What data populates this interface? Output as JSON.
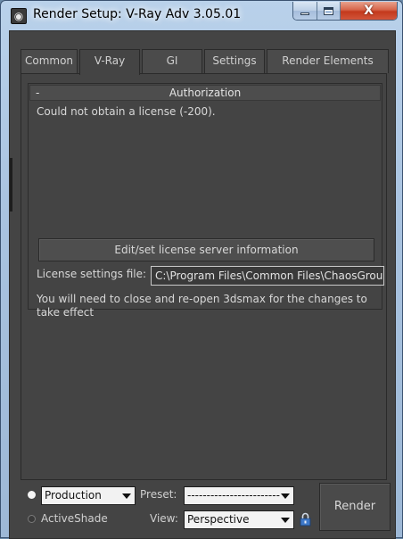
{
  "window": {
    "title": "Render Setup: V-Ray Adv 3.05.01",
    "app_icon": "3ds-max-icon",
    "caption_buttons": [
      "minimize-icon",
      "maximize-icon",
      "close-icon"
    ],
    "close_glyph": "X"
  },
  "tabs": [
    {
      "label": "Common",
      "active": false
    },
    {
      "label": "V-Ray",
      "active": true
    },
    {
      "label": "GI",
      "active": false
    },
    {
      "label": "Settings",
      "active": false
    },
    {
      "label": "Render Elements",
      "active": false
    }
  ],
  "authorization": {
    "toggle": "-",
    "title": "Authorization",
    "error_text": "Could not obtain a license (-200).",
    "edit_button_label": "Edit/set license server information",
    "license_file_label": "License settings file:",
    "license_file_value": "C:\\Program Files\\Common Files\\ChaosGrou",
    "restart_note": "You will need to close and re-open 3dsmax for the changes to take effect"
  },
  "bottom": {
    "mode_production": {
      "value": "Production",
      "selected": true
    },
    "mode_activeshade": {
      "label": "ActiveShade",
      "selected": false
    },
    "preset_label": "Preset:",
    "preset_value": "------------------------",
    "view_label": "View:",
    "view_value": "Perspective",
    "lock_icon": "lock-icon",
    "render_button_label": "Render"
  },
  "colors": {
    "panel_background": "#444444",
    "text": "#d8d8d8",
    "title_bar": "#a9c3e0",
    "close_button": "#c3391c"
  }
}
